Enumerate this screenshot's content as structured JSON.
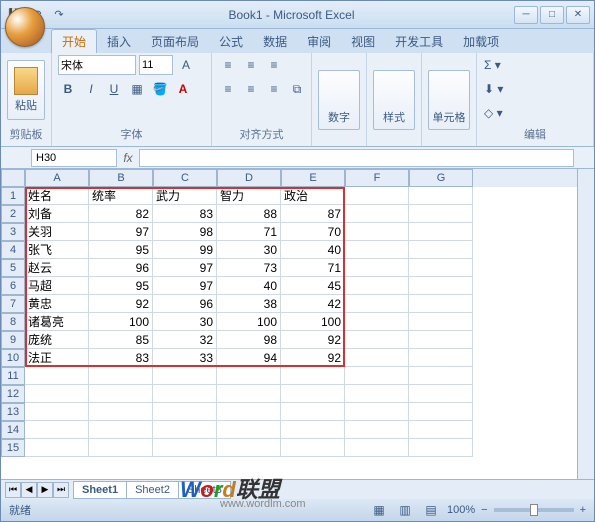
{
  "window": {
    "title": "Book1 - Microsoft Excel"
  },
  "qat": {
    "save": "💾",
    "undo": "↶",
    "redo": "↷"
  },
  "tabs": {
    "t0": "开始",
    "t1": "插入",
    "t2": "页面布局",
    "t3": "公式",
    "t4": "数据",
    "t5": "审阅",
    "t6": "视图",
    "t7": "开发工具",
    "t8": "加载项"
  },
  "ribbon": {
    "clipboard": {
      "paste": "粘贴",
      "label": "剪贴板"
    },
    "font": {
      "name": "宋体",
      "size": "11",
      "label": "字体"
    },
    "align": {
      "label": "对齐方式"
    },
    "number": {
      "btn": "数字"
    },
    "styles": {
      "btn": "样式"
    },
    "cells": {
      "btn": "单元格"
    },
    "editing": {
      "label": "编辑"
    }
  },
  "namebox": "H30",
  "cols": [
    "A",
    "B",
    "C",
    "D",
    "E",
    "F",
    "G"
  ],
  "rowNums": [
    "1",
    "2",
    "3",
    "4",
    "5",
    "6",
    "7",
    "8",
    "9",
    "10",
    "11",
    "12",
    "13",
    "14",
    "15"
  ],
  "headers": {
    "c0": "姓名",
    "c1": "统率",
    "c2": "武力",
    "c3": "智力",
    "c4": "政治"
  },
  "data": [
    {
      "n": "刘备",
      "v": [
        "82",
        "83",
        "88",
        "87"
      ]
    },
    {
      "n": "关羽",
      "v": [
        "97",
        "98",
        "71",
        "70"
      ]
    },
    {
      "n": "张飞",
      "v": [
        "95",
        "99",
        "30",
        "40"
      ]
    },
    {
      "n": "赵云",
      "v": [
        "96",
        "97",
        "73",
        "71"
      ]
    },
    {
      "n": "马超",
      "v": [
        "95",
        "97",
        "40",
        "45"
      ]
    },
    {
      "n": "黄忠",
      "v": [
        "92",
        "96",
        "38",
        "42"
      ]
    },
    {
      "n": "诸葛亮",
      "v": [
        "100",
        "30",
        "100",
        "100"
      ]
    },
    {
      "n": "庞统",
      "v": [
        "85",
        "32",
        "98",
        "92"
      ]
    },
    {
      "n": "法正",
      "v": [
        "83",
        "33",
        "94",
        "92"
      ]
    }
  ],
  "sheets": {
    "s1": "Sheet1",
    "s2": "Sheet2",
    "s3": "Sheet3"
  },
  "status": {
    "ready": "就绪",
    "zoom": "100%"
  },
  "watermark": {
    "a": "W",
    "b": "o",
    "c": "r",
    "d": "d",
    "e": "联盟",
    "url": "www.wordlm.com"
  },
  "chart_data": {
    "type": "table",
    "title": "",
    "columns": [
      "姓名",
      "统率",
      "武力",
      "智力",
      "政治"
    ],
    "rows": [
      [
        "刘备",
        82,
        83,
        88,
        87
      ],
      [
        "关羽",
        97,
        98,
        71,
        70
      ],
      [
        "张飞",
        95,
        99,
        30,
        40
      ],
      [
        "赵云",
        96,
        97,
        73,
        71
      ],
      [
        "马超",
        95,
        97,
        40,
        45
      ],
      [
        "黄忠",
        92,
        96,
        38,
        42
      ],
      [
        "诸葛亮",
        100,
        30,
        100,
        100
      ],
      [
        "庞统",
        85,
        32,
        98,
        92
      ],
      [
        "法正",
        83,
        33,
        94,
        92
      ]
    ]
  }
}
